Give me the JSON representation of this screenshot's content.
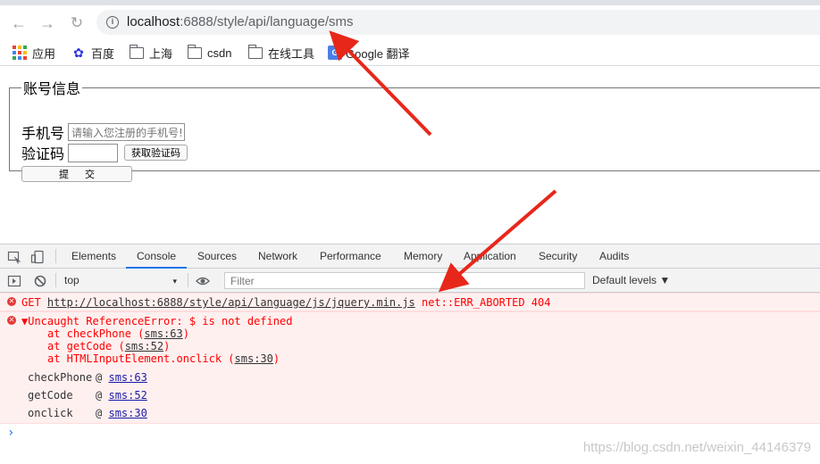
{
  "browser": {
    "url_host": "localhost",
    "url_rest": ":6888/style/api/language/sms",
    "info_glyph": "i"
  },
  "bookmarks": [
    {
      "label": "应用",
      "icon": "apps-grid-icon"
    },
    {
      "label": "百度",
      "icon": "baidu-paw-icon"
    },
    {
      "label": "上海",
      "icon": "folder-icon"
    },
    {
      "label": "csdn",
      "icon": "folder-icon"
    },
    {
      "label": "在线工具",
      "icon": "folder-icon"
    },
    {
      "label": "Google 翻译",
      "icon": "google-translate-icon"
    }
  ],
  "form": {
    "legend": "账号信息",
    "phone_label": "手机号",
    "phone_placeholder": "请输入您注册的手机号!",
    "code_label": "验证码",
    "get_code_label": "获取验证码",
    "submit_label": "提交"
  },
  "devtools": {
    "tabs": [
      "Elements",
      "Console",
      "Sources",
      "Network",
      "Performance",
      "Memory",
      "Application",
      "Security",
      "Audits"
    ],
    "active_tab": "Console",
    "context": "top",
    "filter_placeholder": "Filter",
    "levels": "Default levels ▼",
    "error1": {
      "method": "GET",
      "url": "http://localhost:6888/style/api/language/js/jquery.min.js",
      "status": "net::ERR_ABORTED 404"
    },
    "error2": {
      "message": "▼Uncaught ReferenceError: $ is not defined",
      "stack": [
        {
          "prefix": "at checkPhone (",
          "link": "sms:63",
          "suffix": ")"
        },
        {
          "prefix": "at getCode (",
          "link": "sms:52",
          "suffix": ")"
        },
        {
          "prefix": "at HTMLInputElement.onclick (",
          "link": "sms:30",
          "suffix": ")"
        }
      ],
      "frames": [
        {
          "fn": "checkPhone",
          "at": "@",
          "link": "sms:63"
        },
        {
          "fn": "getCode",
          "at": "@",
          "link": "sms:52"
        },
        {
          "fn": "onclick",
          "at": "@",
          "link": "sms:30"
        }
      ]
    },
    "prompt": "›"
  },
  "watermark": "https://blog.csdn.net/weixin_44146379",
  "colors": {
    "accent": "#1a73e8",
    "error_text": "#ff0000",
    "error_bg": "#fff0f0",
    "annotation_arrow": "#e8271b"
  }
}
